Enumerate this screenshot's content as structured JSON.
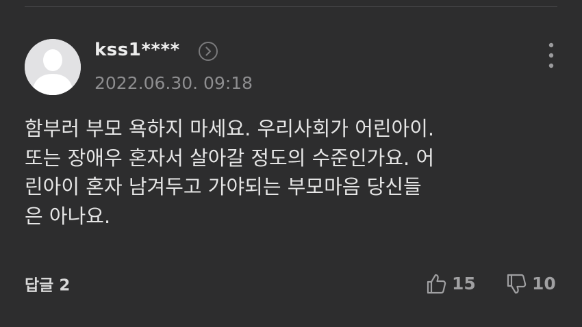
{
  "comment": {
    "author": "kss1****",
    "timestamp": "2022.06.30. 09:18",
    "body_lines": [
      "함부러 부모 욕하지 마세요. 우리사회가 어린아이.",
      "또는 장애우 혼자서 살아갈 정도의 수준인가요. 어",
      "린아이 혼자 남겨두고 가야되는 부모마음 당신들",
      "은 아나요."
    ],
    "reply_label": "답글",
    "reply_count": "2",
    "like_count": "15",
    "dislike_count": "10"
  },
  "icons": {
    "avatar": "default-user-avatar",
    "profile_link": "chevron-right-circle-icon",
    "more": "more-vertical-icon",
    "like": "thumbs-up-icon",
    "dislike": "thumbs-down-icon"
  },
  "colors": {
    "background": "#2d2d2e",
    "text_primary": "#e6e6e6",
    "text_secondary": "#8e8e90",
    "avatar_bg": "#e2e2e4",
    "avatar_figure": "#ffffff"
  }
}
